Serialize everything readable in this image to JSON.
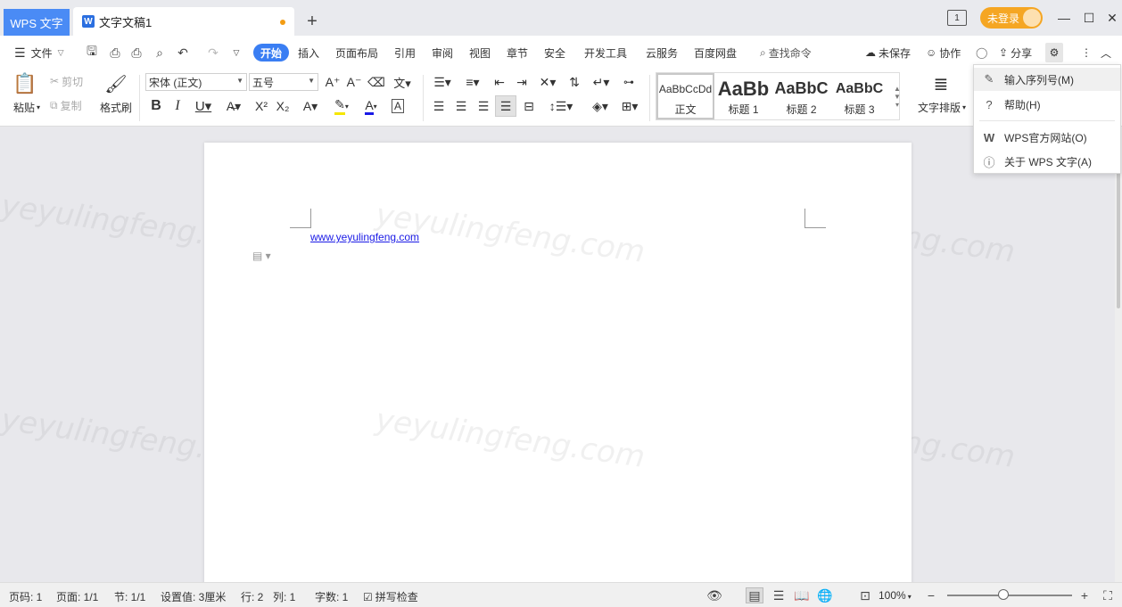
{
  "titlebar": {
    "app_tab": "WPS 文字",
    "doc_tab": "文字文稿1",
    "new_tab": "+",
    "panel_icon": "1",
    "login": "未登录"
  },
  "menubar": {
    "file": "文件",
    "tabs": [
      "开始",
      "插入",
      "页面布局",
      "引用",
      "审阅",
      "视图",
      "章节",
      "安全",
      "开发工具",
      "云服务",
      "百度网盘"
    ],
    "search": "查找命令",
    "unsaved": "未保存",
    "collab": "协作",
    "share": "分享"
  },
  "ribbon": {
    "paste": "粘贴",
    "cut": "剪切",
    "copy": "复制",
    "format_painter": "格式刷",
    "font_name": "宋体 (正文)",
    "font_size": "五号",
    "styles": [
      {
        "sample": "AaBbCcDd",
        "name": "正文"
      },
      {
        "sample": "AaBb",
        "name": "标题 1"
      },
      {
        "sample": "AaBbC",
        "name": "标题 2"
      },
      {
        "sample": "AaBbC",
        "name": "标题 3"
      }
    ],
    "text_layout": "文字排版"
  },
  "document": {
    "link": "www.yeyulingfeng.com",
    "watermark": "yeyulingfeng.com"
  },
  "dropdown": {
    "items": [
      "输入序列号(M)",
      "帮助(H)",
      "WPS官方网站(O)",
      "关于 WPS 文字(A)"
    ]
  },
  "statusbar": {
    "page_no": "页码: 1",
    "pages": "页面: 1/1",
    "section": "节: 1/1",
    "setting": "设置值: 3厘米",
    "row": "行: 2",
    "col": "列: 1",
    "words": "字数: 1",
    "spell": "拼写检查",
    "zoom": "100%",
    "zoom_level": 0.45
  }
}
